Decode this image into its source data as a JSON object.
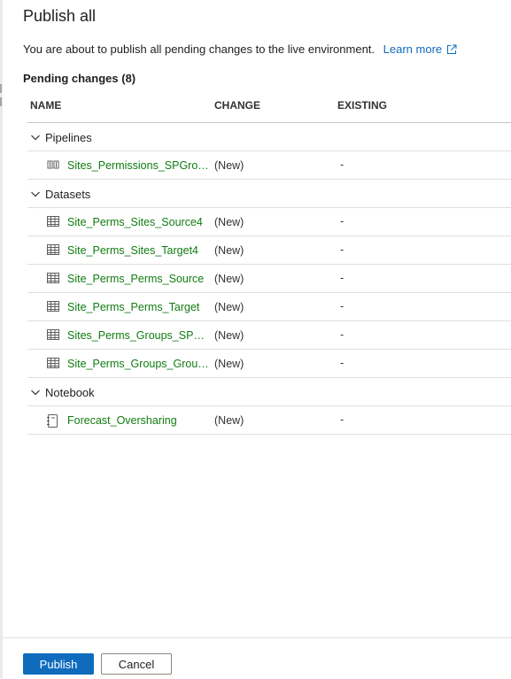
{
  "dialog": {
    "title": "Publish all",
    "description": "You are about to publish all pending changes to the live environment.",
    "learn_more": "Learn more",
    "pending_label": "Pending changes (8)"
  },
  "table": {
    "columns": [
      "NAME",
      "CHANGE",
      "EXISTING"
    ],
    "groups": [
      {
        "label": "Pipelines",
        "items": [
          {
            "name": "Sites_Permissions_SPGrou...",
            "change": "(New)",
            "existing": "-",
            "icon": "pipeline-icon"
          }
        ]
      },
      {
        "label": "Datasets",
        "items": [
          {
            "name": "Site_Perms_Sites_Source4",
            "change": "(New)",
            "existing": "-",
            "icon": "dataset-table-icon"
          },
          {
            "name": "Site_Perms_Sites_Target4",
            "change": "(New)",
            "existing": "-",
            "icon": "dataset-table-icon"
          },
          {
            "name": "Site_Perms_Perms_Source",
            "change": "(New)",
            "existing": "-",
            "icon": "dataset-table-icon"
          },
          {
            "name": "Site_Perms_Perms_Target",
            "change": "(New)",
            "existing": "-",
            "icon": "dataset-table-icon"
          },
          {
            "name": "Sites_Perms_Groups_SPOG...",
            "change": "(New)",
            "existing": "-",
            "icon": "dataset-table-icon"
          },
          {
            "name": "Site_Perms_Groups_Group...",
            "change": "(New)",
            "existing": "-",
            "icon": "dataset-table-icon"
          }
        ]
      },
      {
        "label": "Notebook",
        "items": [
          {
            "name": "Forecast_Oversharing",
            "change": "(New)",
            "existing": "-",
            "icon": "notebook-icon"
          }
        ]
      }
    ]
  },
  "footer": {
    "publish_label": "Publish",
    "cancel_label": "Cancel"
  },
  "colors": {
    "accent": "#0f6cbd",
    "item_name": "#107c10",
    "divider": "#e1dfdd"
  }
}
